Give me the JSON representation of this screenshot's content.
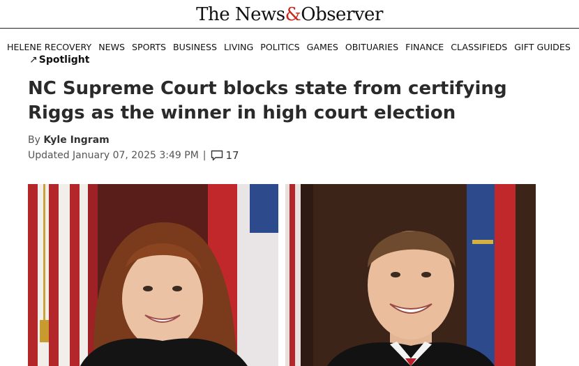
{
  "masthead": {
    "logo_part1": "The News",
    "logo_amp": "&",
    "logo_part2": "Observer"
  },
  "nav": {
    "items": [
      "HELENE RECOVERY",
      "NEWS",
      "SPORTS",
      "BUSINESS",
      "LIVING",
      "POLITICS",
      "GAMES",
      "OBITUARIES",
      "FINANCE",
      "CLASSIFIEDS",
      "GIFT GUIDES"
    ]
  },
  "article": {
    "section": "Spotlight",
    "headline": "NC Supreme Court blocks state from certifying Riggs as the winner in high court election",
    "byline_prefix": "By ",
    "author": "Kyle Ingram",
    "updated": "Updated January 07, 2025 3:49 PM",
    "comment_count": "17"
  },
  "colors": {
    "accent": "#c8281e",
    "text": "#2a2a2a",
    "muted": "#555555"
  }
}
